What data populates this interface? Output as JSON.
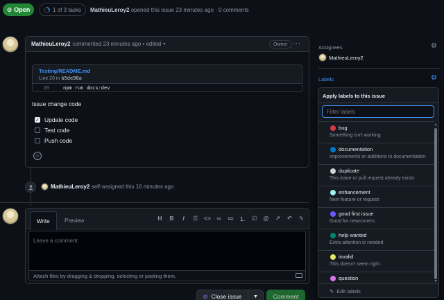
{
  "header": {
    "state": "Open",
    "tasks": "1 of 3 tasks",
    "author": "MathieuLeroy2",
    "opened_text": "opened this issue 23 minutes ago · 0 comments"
  },
  "comment": {
    "author": "MathieuLeroy2",
    "meta": "commented 23 minutes ago • edited",
    "role": "Owner",
    "code_ref": {
      "path": "Testing/README.md",
      "line_prefix": "Line 20 in",
      "commit": "b5de98a",
      "line_number": "20",
      "code": "npm run docs:dev"
    },
    "title": "Issue change code",
    "tasks": [
      {
        "label": "Update code",
        "checked": true
      },
      {
        "label": "Test code",
        "checked": false
      },
      {
        "label": "Push code",
        "checked": false
      }
    ]
  },
  "event": {
    "user": "MathieuLeroy2",
    "text": "self-assigned this 16 minutes ago"
  },
  "new_comment": {
    "tab_write": "Write",
    "tab_preview": "Preview",
    "placeholder": "Leave a comment",
    "attach_text": "Attach files by dragging & dropping, selecting or pasting them.",
    "close_label": "Close issue",
    "comment_label": "Comment"
  },
  "sidebar": {
    "assignees_heading": "Assignees",
    "assignee": "MathieuLeroy2",
    "labels_heading": "Labels"
  },
  "labels_popup": {
    "title": "Apply labels to this issue",
    "filter_placeholder": "Filter labels",
    "edit_label": "Edit labels",
    "labels": [
      {
        "name": "bug",
        "description": "Something isn't working",
        "color": "#d73a4a"
      },
      {
        "name": "documentation",
        "description": "Improvements or additions to documentation",
        "color": "#0075ca"
      },
      {
        "name": "duplicate",
        "description": "This issue or pull request already exists",
        "color": "#cfd3d7"
      },
      {
        "name": "enhancement",
        "description": "New feature or request",
        "color": "#a2eeef"
      },
      {
        "name": "good first issue",
        "description": "Good for newcomers",
        "color": "#7057ff"
      },
      {
        "name": "help wanted",
        "description": "Extra attention is needed",
        "color": "#008672"
      },
      {
        "name": "invalid",
        "description": "This doesn't seem right",
        "color": "#e4e669"
      },
      {
        "name": "question",
        "description": "",
        "color": "#d876e3"
      }
    ]
  },
  "colors": {
    "accent": "#4493f8",
    "open_green": "#238636",
    "background": "#0d1117"
  }
}
